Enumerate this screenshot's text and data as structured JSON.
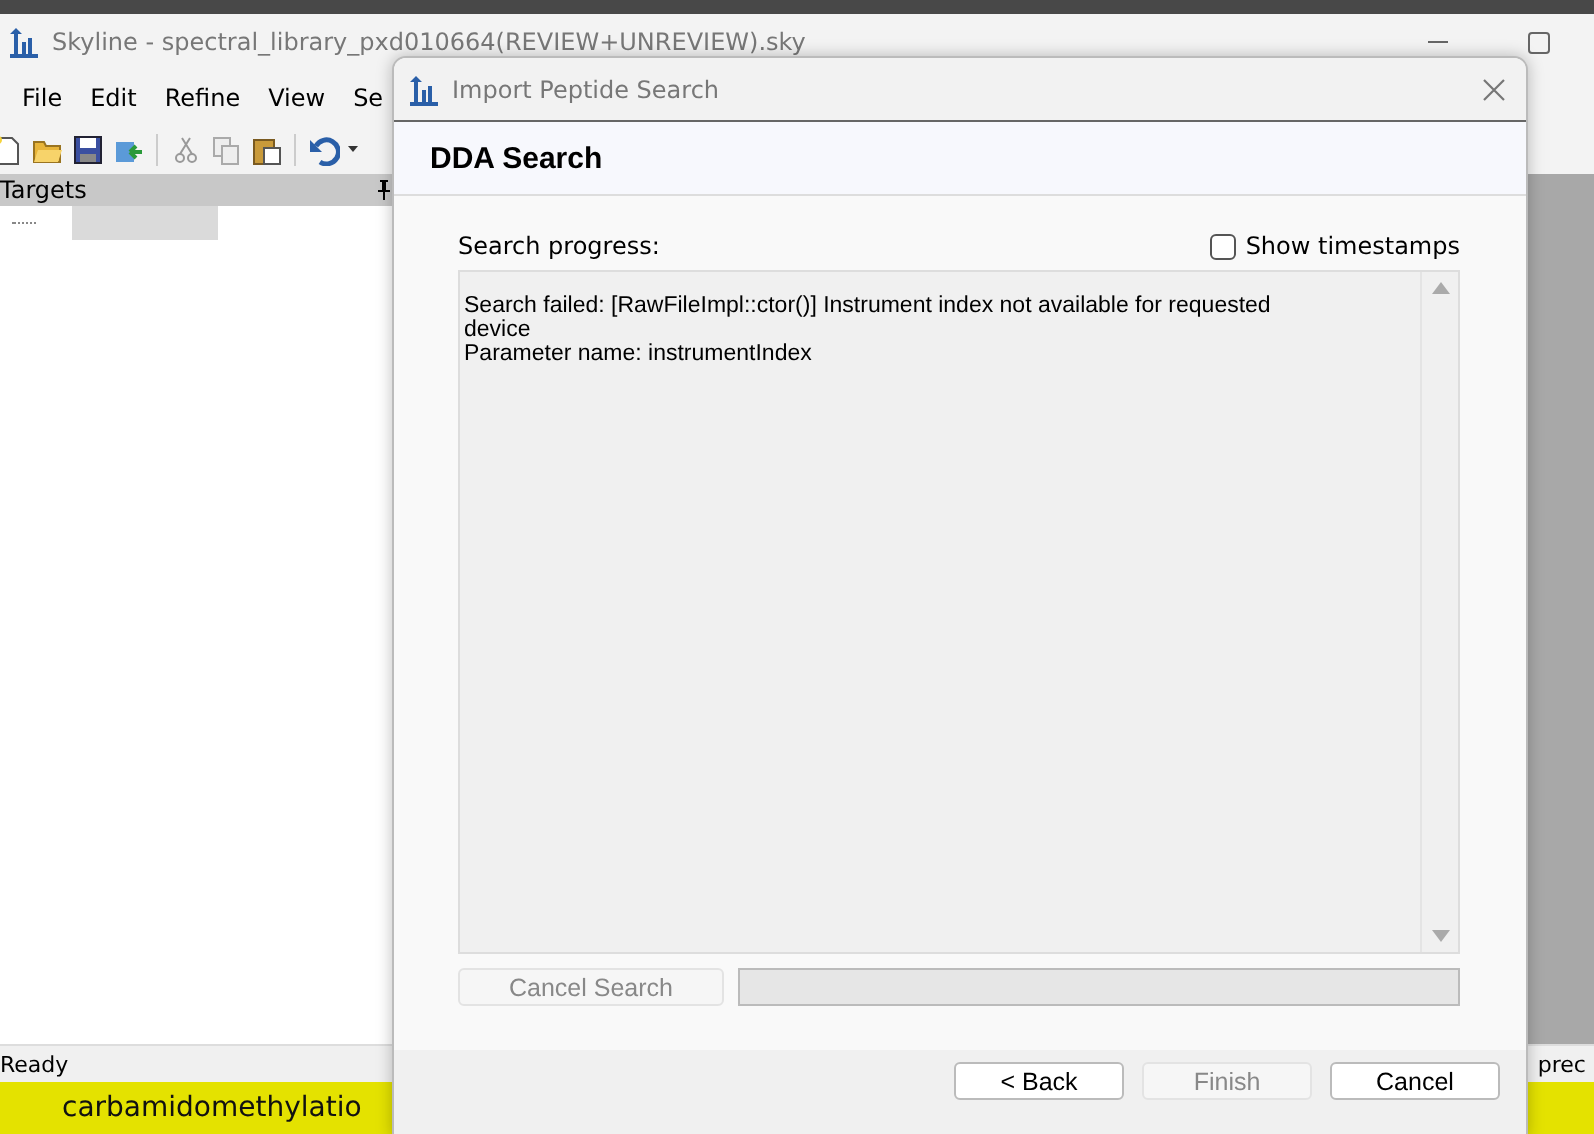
{
  "app": {
    "title": "Skyline - spectral_library_pxd010664(REVIEW+UNREVIEW).sky",
    "menu": [
      "File",
      "Edit",
      "Refine",
      "View",
      "Se"
    ],
    "panel": {
      "title": "Targets"
    },
    "status": "Ready",
    "status_right": "prec",
    "highlight": "carbamidomethylatio"
  },
  "dialog": {
    "title": "Import Peptide Search",
    "heading": "DDA Search",
    "progress_label": "Search progress:",
    "show_timestamps": {
      "label": "Show timestamps",
      "checked": false
    },
    "log": [
      "Search failed: [RawFileImpl::ctor()] Instrument index not available for requested",
      "device",
      "Parameter name: instrumentIndex"
    ],
    "cancel_search": {
      "label": "Cancel Search",
      "disabled": true
    },
    "progress": {
      "level": 0
    },
    "buttons": [
      {
        "label": "< Back",
        "disabled": false
      },
      {
        "label": "Finish",
        "disabled": true
      },
      {
        "label": "Cancel",
        "disabled": false
      }
    ]
  }
}
